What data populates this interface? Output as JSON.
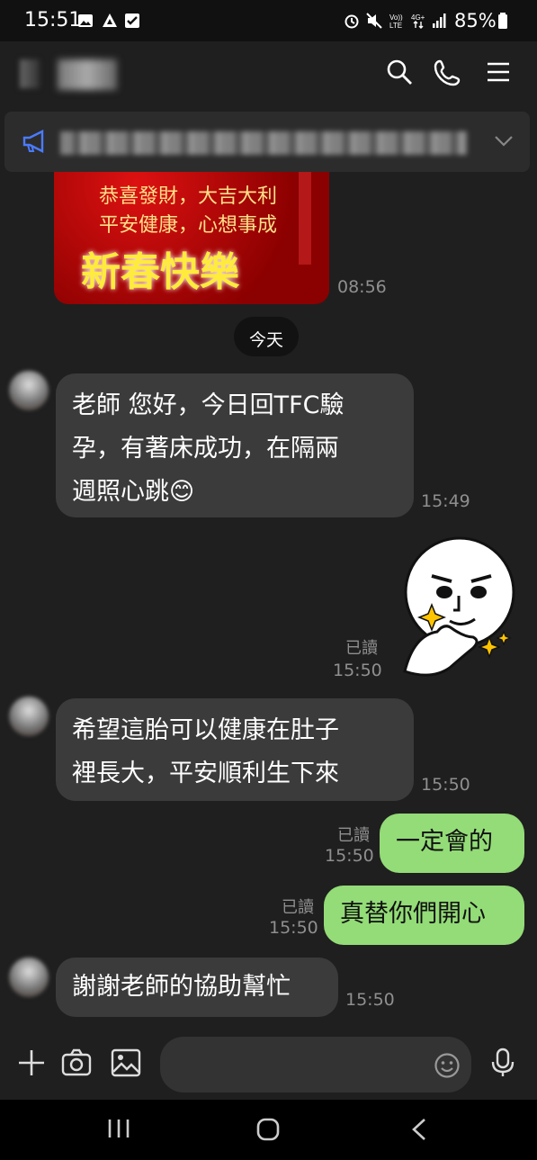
{
  "status_bar": {
    "time": "15:51",
    "battery": "85%"
  },
  "header": {
    "icons": [
      "search-icon",
      "phone-icon",
      "menu-icon"
    ]
  },
  "announcement": {
    "icon": "megaphone-icon"
  },
  "messages": {
    "card": {
      "line1": "恭喜發財，大吉大利",
      "line2": "平安健康，心想事成",
      "line3": "新春快樂",
      "time": "08:56"
    },
    "date_divider": "今天",
    "m1": {
      "lines": [
        "老師 您好，今日回TFC驗",
        "孕，有著床成功，在隔兩",
        "週照心跳😊"
      ],
      "time": "15:49"
    },
    "sticker": {
      "read": "已讀",
      "time": "15:50"
    },
    "m2": {
      "lines": [
        "希望這胎可以健康在肚子",
        "裡長大，平安順利生下來"
      ],
      "time": "15:50"
    },
    "m3": {
      "text": "一定會的",
      "read": "已讀",
      "time": "15:50"
    },
    "m4": {
      "text": "真替你們開心",
      "read": "已讀",
      "time": "15:50"
    },
    "m5": {
      "text": "謝謝老師的協助幫忙",
      "time": "15:50"
    }
  },
  "input_bar": {
    "icons": [
      "plus-icon",
      "camera-icon",
      "image-icon",
      "emoji-icon",
      "mic-icon"
    ]
  },
  "nav_bar": {
    "icons": [
      "recents-icon",
      "home-icon",
      "back-icon"
    ]
  },
  "colors": {
    "outgoing_bubble": "#93dc77",
    "incoming_bubble": "#3b3b3b",
    "background": "#1f1f1f"
  }
}
